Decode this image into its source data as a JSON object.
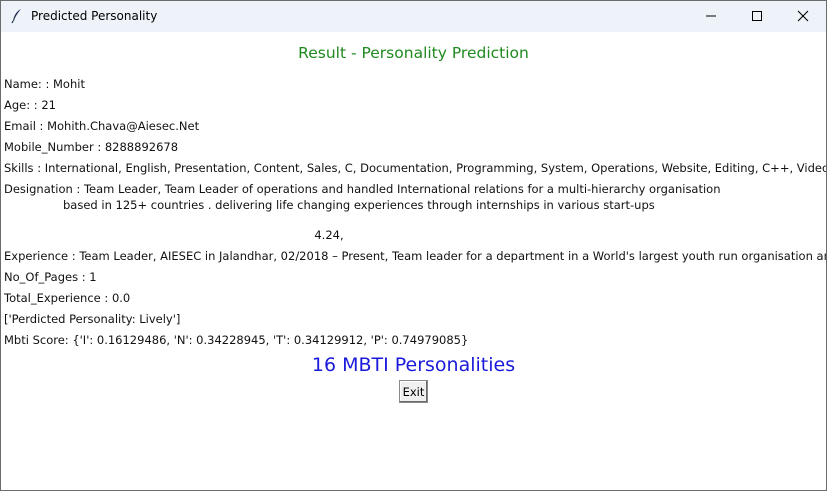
{
  "window": {
    "title": "Predicted Personality"
  },
  "heading": "Result - Personality Prediction",
  "fields": {
    "name": {
      "label": "Name: :",
      "value": "Mohit"
    },
    "age": {
      "label": "Age: :",
      "value": "21"
    },
    "email": {
      "label": "Email :",
      "value": "Mohith.Chava@Aiesec.Net"
    },
    "mobile": {
      "label": "Mobile_Number :",
      "value": "8288892678"
    },
    "skills": {
      "label": "Skills :",
      "value": "International, English, Presentation, Content, Sales, C, Documentation, Programming, System, Operations, Website, Editing, C++, Video,"
    },
    "designation": {
      "label": "Designation :",
      "value_line1": "Team Leader, Team Leader of operations and handled International relations for a multi-hierarchy organisation",
      "value_line2": "based in 125+ countries . delivering life changing experiences through internships in various start-ups",
      "value_line3": "4.24,"
    },
    "experience": {
      "label": "Experience :",
      "value": "Team Leader, AIESEC in Jalandhar, 02/2018 – Present, Team leader for a department in a World's largest youth run organisation and responsible f"
    },
    "pages": {
      "label": "No_Of_Pages :",
      "value": "1"
    },
    "total_experience": {
      "label": "Total_Experience :",
      "value": "0.0"
    },
    "predicted": "['Perdicted Personality: Lively']",
    "mbti_score": {
      "label": "Mbti Score:",
      "value": "{'I': 0.16129486, 'N': 0.34228945, 'T': 0.34129912, 'P': 0.74979085}"
    }
  },
  "mbti_title": "16 MBTI Personalities",
  "exit_label": "Exit",
  "icons": {
    "app": "feather-icon",
    "minimize": "minimize-icon",
    "maximize": "maximize-icon",
    "close": "close-icon"
  }
}
